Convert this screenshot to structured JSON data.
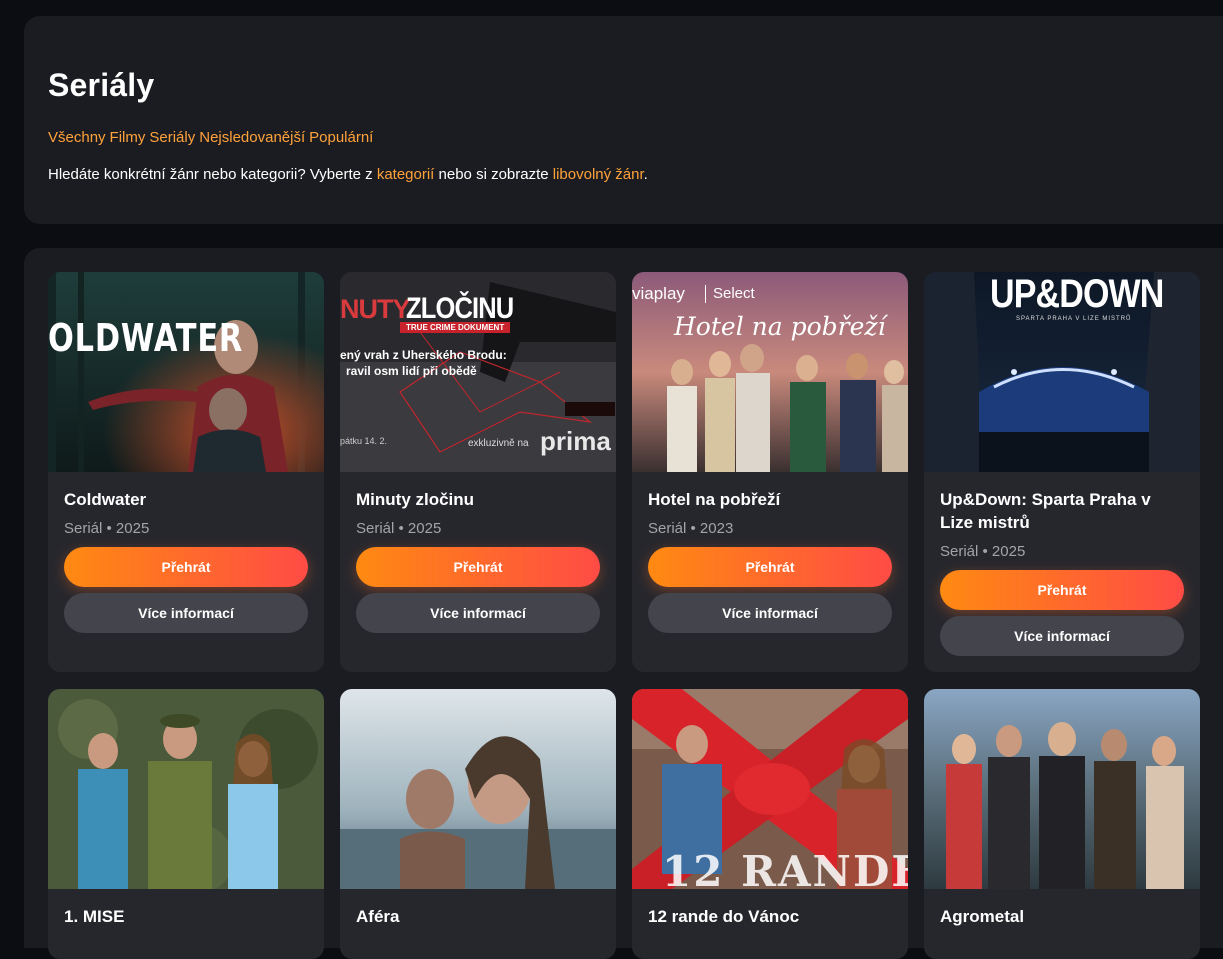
{
  "page": {
    "title": "Seriály",
    "filters": [
      "Všechny",
      "Filmy",
      "Seriály",
      "Nejsledovanější",
      "Populární"
    ],
    "hint": {
      "prefix": "Hledáte konkrétní žánr nebo kategorii? Vyberte z ",
      "link1": "kategorií",
      "middle": " nebo si zobrazte ",
      "link2": "libovolný žánr",
      "suffix": "."
    }
  },
  "colors": {
    "accent": "#ffa23a",
    "play_gradient_start": "#ff8a12",
    "play_gradient_end": "#ff4b45",
    "background": "#0c0d12",
    "panel": "#1b1c22",
    "card": "#26272d"
  },
  "buttons": {
    "play": "Přehrát",
    "info": "Více informací"
  },
  "cards": [
    {
      "title": "Coldwater",
      "meta": "Seriál • 2025",
      "poster_text": "OLDWATER"
    },
    {
      "title": "Minuty zločinu",
      "meta": "Seriál • 2025",
      "poster_text": "ZLOČINU",
      "poster_brand": "prima",
      "poster_tag": "TRUE CRIME DOKUMENT",
      "poster_sub1": "ený vrah z Uherského Brodu:",
      "poster_sub2": "ravil osm lidí při obědě",
      "poster_note": "exkluzivně na",
      "poster_date": "pátku 14. 2.",
      "poster_prefix": "NUTY"
    },
    {
      "title": "Hotel na pobřeží",
      "meta": "Seriál • 2023",
      "poster_brand": "viaplay",
      "poster_brand2": "Select",
      "poster_text": "Hotel na pobřeží"
    },
    {
      "title": "Up&Down: Sparta Praha v Lize mistrů",
      "meta": "Seriál • 2025",
      "poster_text": "UP&DOWN",
      "poster_sub1": "SPARTA PRAHA V LIZE MISTRŮ"
    },
    {
      "title": "1. MISE",
      "meta": ""
    },
    {
      "title": "Aféra",
      "meta": ""
    },
    {
      "title": "12 rande do Vánoc",
      "meta": "",
      "poster_text": "12 RANDE"
    },
    {
      "title": "Agrometal",
      "meta": ""
    }
  ]
}
